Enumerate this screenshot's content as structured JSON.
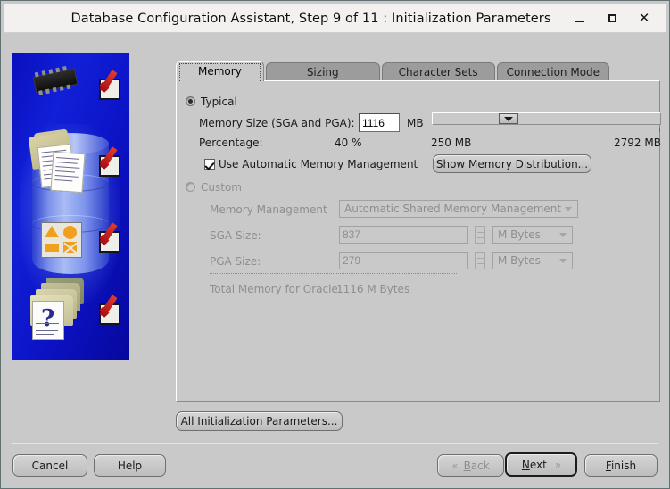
{
  "window": {
    "title": "Database Configuration Assistant, Step 9 of 11 : Initialization Parameters",
    "minimize_label": "Minimize",
    "maximize_label": "Maximize",
    "close_label": "Close"
  },
  "tabs": [
    {
      "label": "Memory",
      "selected": true
    },
    {
      "label": "Sizing",
      "selected": false
    },
    {
      "label": "Character Sets",
      "selected": false
    },
    {
      "label": "Connection Mode",
      "selected": false
    }
  ],
  "typical": {
    "radio_label": "Typical",
    "selected": true,
    "memory_size_label": "Memory Size (SGA and PGA):",
    "memory_size_value": "1116",
    "memory_size_unit": "MB",
    "percentage_label": "Percentage:",
    "percentage_value": "40 %",
    "slider_min_label": "250 MB",
    "slider_max_label": "2792 MB",
    "amm_checkbox_label": "Use Automatic Memory Management",
    "amm_checked": true,
    "show_distribution_button": "Show Memory Distribution..."
  },
  "custom": {
    "radio_label": "Custom",
    "selected": false,
    "memory_management_label": "Memory Management",
    "memory_management_value": "Automatic Shared Memory Management",
    "sga_label": "SGA Size:",
    "sga_value": "837",
    "sga_unit": "M Bytes",
    "pga_label": "PGA Size:",
    "pga_value": "279",
    "pga_unit": "M Bytes",
    "total_label": "Total Memory for Oracle:",
    "total_value": "1116 M Bytes"
  },
  "all_params_button": "All Initialization Parameters...",
  "footer": {
    "cancel": "Cancel",
    "help": "Help",
    "back": "Back",
    "next": "Next",
    "finish": "Finish"
  },
  "illustration": {
    "alt": "Oracle database configuration illustration with chip, documents, shapes and folders, each with a red check mark"
  }
}
